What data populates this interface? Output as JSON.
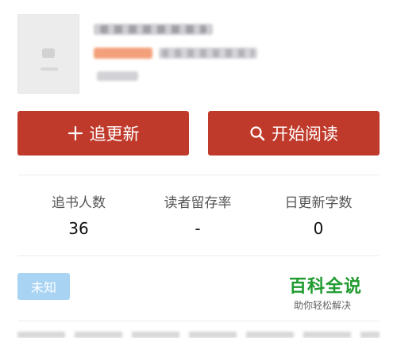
{
  "book": {
    "cover_alt": "book-cover-placeholder"
  },
  "actions": {
    "follow_label": "追更新",
    "follow_icon": "plus-icon",
    "read_label": "开始阅读",
    "read_icon": "search-icon",
    "button_color": "#c03a2b"
  },
  "stats": [
    {
      "label": "追书人数",
      "value": "36"
    },
    {
      "label": "读者留存率",
      "value": "-"
    },
    {
      "label": "日更新字数",
      "value": "0"
    }
  ],
  "status_badge": {
    "label": "未知",
    "color": "#a8d3f3"
  },
  "watermark": {
    "title": "百科全说",
    "subtitle": "助你轻松解决",
    "color": "#1f9b2e"
  }
}
